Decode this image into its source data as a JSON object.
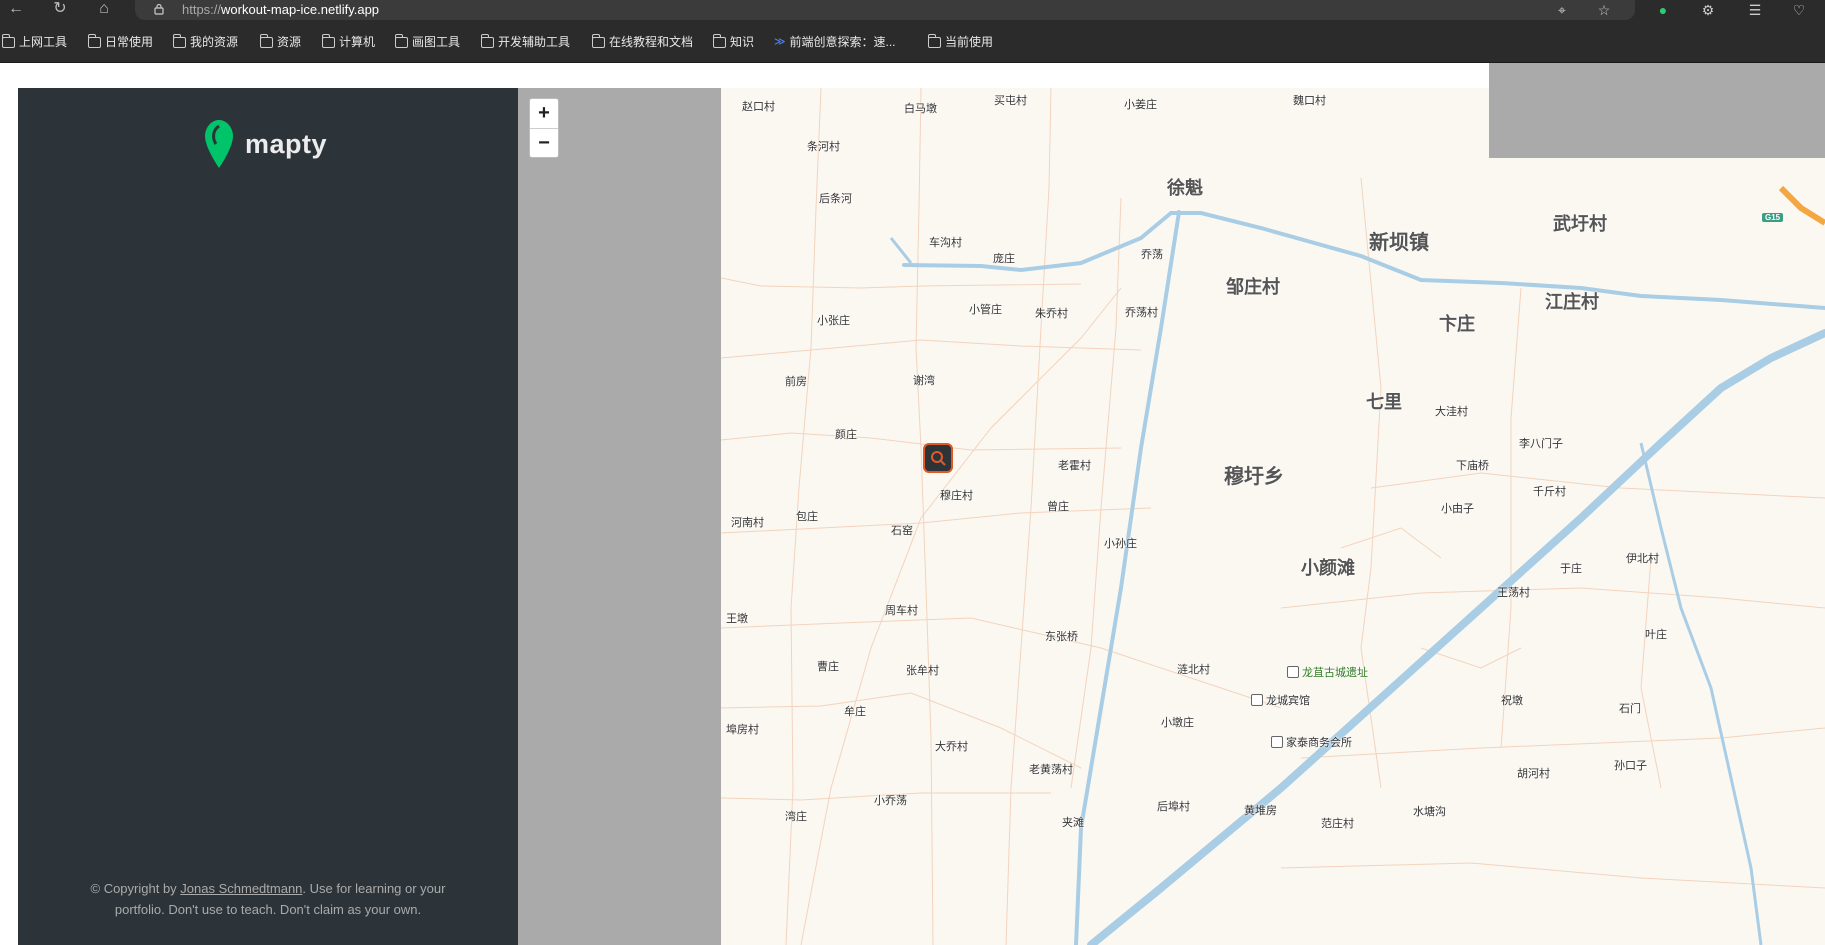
{
  "browser": {
    "url_protocol": "https://",
    "url_host": "workout-map-ice.netlify.app",
    "bookmarks": [
      "上网工具",
      "日常使用",
      "我的资源",
      "资源",
      "计算机",
      "画图工具",
      "开发辅助工具",
      "在线教程和文档",
      "知识",
      "前端创意探索：速...",
      "当前使用"
    ]
  },
  "sidebar": {
    "logo_text": "mapty",
    "copyright_prefix": "© Copyright by ",
    "copyright_author": "Jonas Schmedtmann",
    "copyright_line1_rest": ". Use for learning or your",
    "copyright_line2": "portfolio. Don't use to teach. Don't claim as your own."
  },
  "map": {
    "zoom_in": "+",
    "zoom_out": "−",
    "highway_shield": "G15",
    "places": [
      {
        "t": "赵口村",
        "c": ""
      },
      {
        "t": "白马墩",
        "c": ""
      },
      {
        "t": "买屯村",
        "c": ""
      },
      {
        "t": "小姜庄",
        "c": ""
      },
      {
        "t": "魏口村",
        "c": ""
      },
      {
        "t": "条河村",
        "c": ""
      },
      {
        "t": "后条河",
        "c": ""
      },
      {
        "t": "徐魁",
        "c": "mid"
      },
      {
        "t": "新坝镇",
        "c": "big"
      },
      {
        "t": "武圩村",
        "c": "mid"
      },
      {
        "t": "车沟村",
        "c": ""
      },
      {
        "t": "庞庄",
        "c": ""
      },
      {
        "t": "乔荡",
        "c": ""
      },
      {
        "t": "邹庄村",
        "c": "mid"
      },
      {
        "t": "江庄村",
        "c": "mid"
      },
      {
        "t": "小张庄",
        "c": ""
      },
      {
        "t": "小管庄",
        "c": ""
      },
      {
        "t": "朱乔村",
        "c": ""
      },
      {
        "t": "乔荡村",
        "c": ""
      },
      {
        "t": "卞庄",
        "c": "mid"
      },
      {
        "t": "前房",
        "c": ""
      },
      {
        "t": "谢湾",
        "c": ""
      },
      {
        "t": "七里",
        "c": "mid"
      },
      {
        "t": "大洼村",
        "c": ""
      },
      {
        "t": "颜庄",
        "c": ""
      },
      {
        "t": "李八门子",
        "c": ""
      },
      {
        "t": "老霍村",
        "c": ""
      },
      {
        "t": "穆圩乡",
        "c": "big"
      },
      {
        "t": "下庙桥",
        "c": ""
      },
      {
        "t": "千斤村",
        "c": ""
      },
      {
        "t": "穆庄村",
        "c": ""
      },
      {
        "t": "河南村",
        "c": ""
      },
      {
        "t": "包庄",
        "c": ""
      },
      {
        "t": "石窑",
        "c": ""
      },
      {
        "t": "曾庄",
        "c": ""
      },
      {
        "t": "小由子",
        "c": ""
      },
      {
        "t": "小孙庄",
        "c": ""
      },
      {
        "t": "伊北村",
        "c": ""
      },
      {
        "t": "小颜滩",
        "c": "mid"
      },
      {
        "t": "于庄",
        "c": ""
      },
      {
        "t": "王墩",
        "c": ""
      },
      {
        "t": "周车村",
        "c": ""
      },
      {
        "t": "王荡村",
        "c": ""
      },
      {
        "t": "东张桥",
        "c": ""
      },
      {
        "t": "叶庄",
        "c": ""
      },
      {
        "t": "曹庄",
        "c": ""
      },
      {
        "t": "张牟村",
        "c": ""
      },
      {
        "t": "涟北村",
        "c": ""
      },
      {
        "t": "龙苴古城遗址",
        "c": "poi"
      },
      {
        "t": "龙城宾馆",
        "c": "poi2"
      },
      {
        "t": "祝墩",
        "c": ""
      },
      {
        "t": "牟庄",
        "c": ""
      },
      {
        "t": "石门",
        "c": ""
      },
      {
        "t": "埠房村",
        "c": ""
      },
      {
        "t": "小墩庄",
        "c": ""
      },
      {
        "t": "家泰商务会所",
        "c": "poi2"
      },
      {
        "t": "大乔村",
        "c": ""
      },
      {
        "t": "老黄荡村",
        "c": ""
      },
      {
        "t": "胡河村",
        "c": ""
      },
      {
        "t": "孙口子",
        "c": ""
      },
      {
        "t": "小乔荡",
        "c": ""
      },
      {
        "t": "湾庄",
        "c": ""
      },
      {
        "t": "夹滩",
        "c": ""
      },
      {
        "t": "后埠村",
        "c": ""
      },
      {
        "t": "黄堆房",
        "c": ""
      },
      {
        "t": "水塘沟",
        "c": ""
      },
      {
        "t": "范庄村",
        "c": ""
      }
    ]
  }
}
